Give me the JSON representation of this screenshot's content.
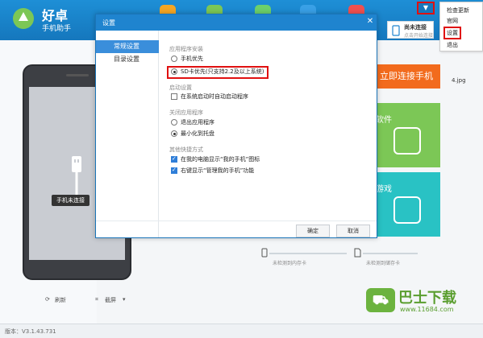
{
  "app": {
    "logo_text_main": "好卓",
    "logo_text_sub": "手机助手",
    "connect_status_title": "尚未连接",
    "connect_status_sub": "点击开始连接",
    "connect_button": "立即连接手机",
    "tile_software": "软件",
    "tile_game": "游戏",
    "file_label": "4.jpg",
    "phone_label": "手机未连接",
    "tool_refresh": "刷新",
    "tool_screenshot": "截屏",
    "storage_internal": "未检测到内存卡",
    "storage_sd": "未检测到储存卡",
    "version": "版本：V3.1.43.731"
  },
  "menu": {
    "items": [
      "检查更新",
      "官网",
      "设置",
      "退出"
    ]
  },
  "dialog": {
    "title": "设置",
    "nav": [
      "常规设置",
      "目录设置"
    ],
    "sections": {
      "install": {
        "title": "应用程序安装",
        "options": [
          "手机优先",
          "SD卡优先(只支持2.2及以上系统)"
        ]
      },
      "startup": {
        "title": "启动设置",
        "options": [
          "在系统启动时自动启动程序"
        ]
      },
      "close": {
        "title": "关闭应用程序",
        "options": [
          "退出应用程序",
          "最小化到托盘"
        ]
      },
      "shortcut": {
        "title": "其他快捷方式",
        "options": [
          "在我的电脑显示“我的手机”图标",
          "右键显示“管理我的手机”功能"
        ]
      }
    },
    "ok": "确定",
    "cancel": "取消"
  },
  "watermark": {
    "text": "巴士下载",
    "url": "www.11684.com"
  },
  "colors": {
    "accent": "#1f84cf",
    "highlight_red": "#e01010",
    "orange": "#f26b1d",
    "green": "#7cc756",
    "cyan": "#29c2c4"
  }
}
